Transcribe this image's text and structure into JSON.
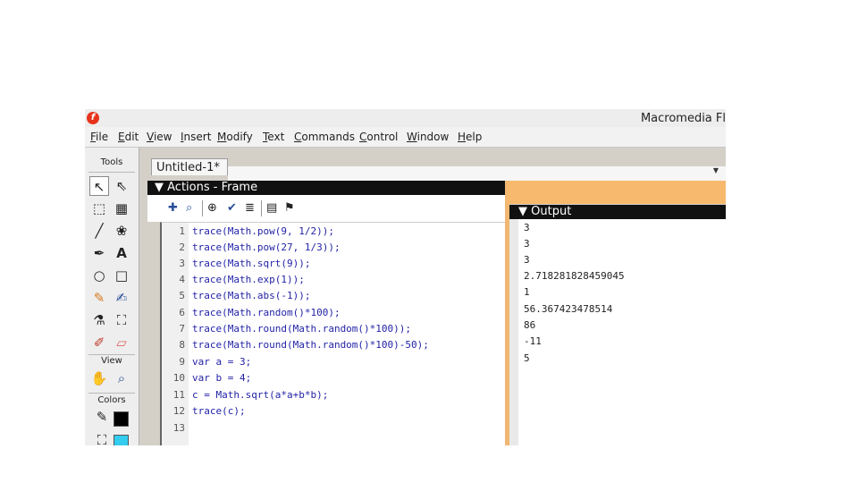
{
  "window": {
    "title": "Macromedia Fl"
  },
  "menu": [
    "File",
    "Edit",
    "View",
    "Insert",
    "Modify",
    "Text",
    "Commands",
    "Control",
    "Window",
    "Help"
  ],
  "tools": {
    "label": "Tools",
    "view_label": "View",
    "colors_label": "Colors"
  },
  "document": {
    "tab_label": "Untitled-1*"
  },
  "actions": {
    "title": "Actions - Frame",
    "code": [
      "trace(Math.pow(9, 1/2));",
      "trace(Math.pow(27, 1/3));",
      "trace(Math.sqrt(9));",
      "trace(Math.exp(1));",
      "trace(Math.abs(-1));",
      "trace(Math.random()*100);",
      "trace(Math.round(Math.random()*100));",
      "trace(Math.round(Math.random()*100)-50);",
      "var a = 3;",
      "var b = 4;",
      "c = Math.sqrt(a*a+b*b);",
      "trace(c);",
      ""
    ],
    "line_numbers": [
      "1",
      "2",
      "3",
      "4",
      "5",
      "6",
      "7",
      "8",
      "9",
      "10",
      "11",
      "12",
      "13"
    ]
  },
  "output": {
    "title": "Output",
    "lines": [
      "3",
      "3",
      "3",
      "2.718281828459045",
      "1",
      "56.367423478514",
      "86",
      "-11",
      "5"
    ]
  },
  "colors": {
    "accent": "#f6b96e",
    "header": "#111111",
    "code": "#2323a8",
    "stroke_swatch": "#000000",
    "fill_swatch": "#33ccee"
  }
}
